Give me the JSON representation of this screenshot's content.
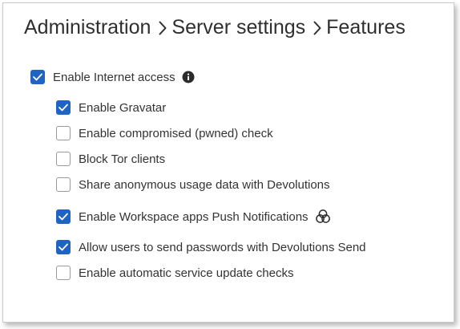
{
  "breadcrumb": {
    "items": [
      "Administration",
      "Server settings",
      "Features"
    ]
  },
  "colors": {
    "checkbox_checked": "#1f64c2",
    "checkbox_unchecked_border": "#9a9a9a",
    "text": "#333333"
  },
  "options": [
    {
      "label": "Enable Internet access",
      "checked": true,
      "level": 0,
      "icon": "info-icon"
    },
    {
      "label": "Enable Gravatar",
      "checked": true,
      "level": 1
    },
    {
      "label": "Enable compromised (pwned) check",
      "checked": false,
      "level": 1
    },
    {
      "label": "Block Tor clients",
      "checked": false,
      "level": 1
    },
    {
      "label": "Share anonymous usage data with Devolutions",
      "checked": false,
      "level": 1
    },
    {
      "label": "Enable Workspace apps Push Notifications",
      "checked": true,
      "level": 1,
      "icon": "workspace-apps-icon"
    },
    {
      "label": "Allow users to send passwords with Devolutions Send",
      "checked": true,
      "level": 1
    },
    {
      "label": "Enable automatic service update checks",
      "checked": false,
      "level": 1
    }
  ]
}
